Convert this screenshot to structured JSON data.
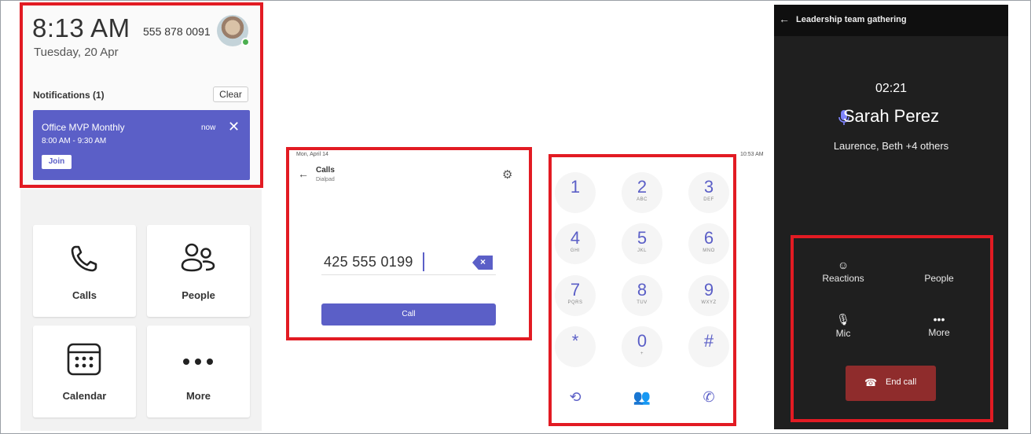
{
  "home": {
    "time": "8:13 AM",
    "phone_number": "555 878 0091",
    "date": "Tuesday, 20 Apr",
    "notifications_title": "Notifications (1)",
    "clear_label": "Clear",
    "notification": {
      "title": "Office MVP Monthly",
      "time_range": "8:00 AM - 9:30 AM",
      "age": "now",
      "join_label": "Join",
      "close_icon": "close-icon"
    },
    "tiles": [
      {
        "label": "Calls",
        "icon": "phone-icon"
      },
      {
        "label": "People",
        "icon": "people-icon"
      },
      {
        "label": "Calendar",
        "icon": "calendar-icon"
      },
      {
        "label": "More",
        "icon": "more-icon"
      }
    ]
  },
  "dialer": {
    "date": "Mon, April 14",
    "title": "Calls",
    "subtitle": "Dialpad",
    "number": "425 555 0199",
    "call_label": "Call"
  },
  "keypad": {
    "keys": [
      {
        "digit": "1",
        "letters": ""
      },
      {
        "digit": "2",
        "letters": "ABC"
      },
      {
        "digit": "3",
        "letters": "DEF"
      },
      {
        "digit": "4",
        "letters": "GHI"
      },
      {
        "digit": "5",
        "letters": "JKL"
      },
      {
        "digit": "6",
        "letters": "MNO"
      },
      {
        "digit": "7",
        "letters": "PQRS"
      },
      {
        "digit": "8",
        "letters": "TUV"
      },
      {
        "digit": "9",
        "letters": "WXYZ"
      },
      {
        "digit": "*",
        "letters": ""
      },
      {
        "digit": "0",
        "letters": "+"
      },
      {
        "digit": "#",
        "letters": ""
      }
    ],
    "bottom_icons": [
      "history-icon",
      "contacts-icon",
      "voicemail-phone-icon"
    ]
  },
  "side_time": "10:53 AM",
  "in_call": {
    "header_title": "Leadership team gathering",
    "timer": "02:21",
    "caller_name": "Sarah Perez",
    "participants": "Laurence, Beth +4 others",
    "controls": [
      {
        "label": "Reactions",
        "icon": "reactions-icon"
      },
      {
        "label": "People",
        "icon": "people-icon"
      },
      {
        "label": "Mic",
        "icon": "mic-icon"
      },
      {
        "label": "More",
        "icon": "more-icon"
      }
    ],
    "end_call_label": "End call"
  },
  "colors": {
    "accent": "#5b5fc7",
    "highlight": "#e21b23",
    "end_call": "#8f2c2c"
  }
}
